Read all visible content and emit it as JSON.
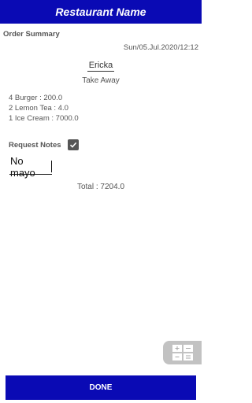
{
  "app_bar": {
    "title": "Restaurant Name"
  },
  "order": {
    "section_title": "Order Summary",
    "datetime": "Sun/05.Jul.2020/12:12",
    "customer_name": "Ericka",
    "order_type": "Take Away",
    "items": [
      "4 Burger : 200.0",
      "2 Lemon Tea : 4.0",
      "1 Ice Cream : 7000.0"
    ]
  },
  "notes": {
    "label": "Request Notes",
    "checked": true,
    "value": "No mayo"
  },
  "total": {
    "text": "Total  :  7204.0"
  },
  "actions": {
    "done_label": "DONE"
  },
  "icons": {
    "checkbox": "checkbox-checked-icon",
    "calculator": "calculator-icon"
  },
  "colors": {
    "primary": "#0a0ab4",
    "fab": "#c2c2c2"
  }
}
